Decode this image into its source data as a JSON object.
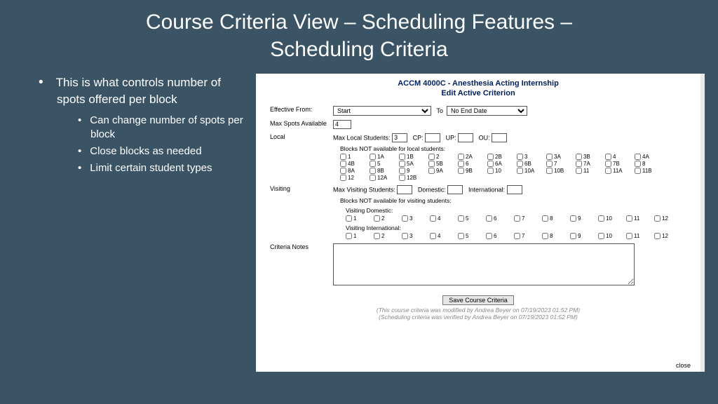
{
  "title_line1": "Course Criteria View – Scheduling Features –",
  "title_line2": "Scheduling Criteria",
  "bullets": {
    "main": "This is what controls number of spots offered per block",
    "sub1": "Can change number of spots per block",
    "sub2": "Close blocks as needed",
    "sub3": "Limit certain student types"
  },
  "panel": {
    "heading1": "ACCM 4000C - Anesthesia Acting Internship",
    "heading2": "Edit Active Criterion",
    "effective_label": "Effective From:",
    "from_value": "Start",
    "to_label": "To",
    "to_value": "No End Date",
    "max_spots_label": "Max Spots Available",
    "max_spots_value": "4",
    "local_label": "Local",
    "max_local_label": "Max Local Students:",
    "max_local_value": "3",
    "cp_label": "CP:",
    "up_label": "UP:",
    "ou_label": "OU:",
    "blocks_local_label": "Blocks NOT available for local students:",
    "local_blocks": [
      "1",
      "1A",
      "1B",
      "2",
      "2A",
      "2B",
      "3",
      "3A",
      "3B",
      "4",
      "4A",
      "4B",
      "5",
      "5A",
      "5B",
      "6",
      "6A",
      "6B",
      "7",
      "7A",
      "7B",
      "8",
      "8A",
      "8B",
      "9",
      "9A",
      "9B",
      "10",
      "10A",
      "10B",
      "11",
      "11A",
      "11B",
      "12",
      "12A",
      "12B"
    ],
    "visiting_label": "Visiting",
    "max_visiting_label": "Max Visiting Students:",
    "domestic_label": "Domestic:",
    "international_label": "International:",
    "blocks_visiting_label": "Blocks NOT available for visiting students:",
    "visiting_domestic_label": "Visiting Domestic:",
    "visiting_intl_label": "Visiting International:",
    "visit_blocks": [
      "1",
      "2",
      "3",
      "4",
      "5",
      "6",
      "7",
      "8",
      "9",
      "10",
      "11",
      "12"
    ],
    "notes_label": "Criteria Notes",
    "save_label": "Save Course Criteria",
    "mod1": "(This course criteria was modified by Andrea Beyer on 07/19/2023 01:52 PM)",
    "mod2": "(Scheduling criteria was verified by Andrea Beyer on 07/19/2023 01:52 PM)",
    "close": "close"
  }
}
